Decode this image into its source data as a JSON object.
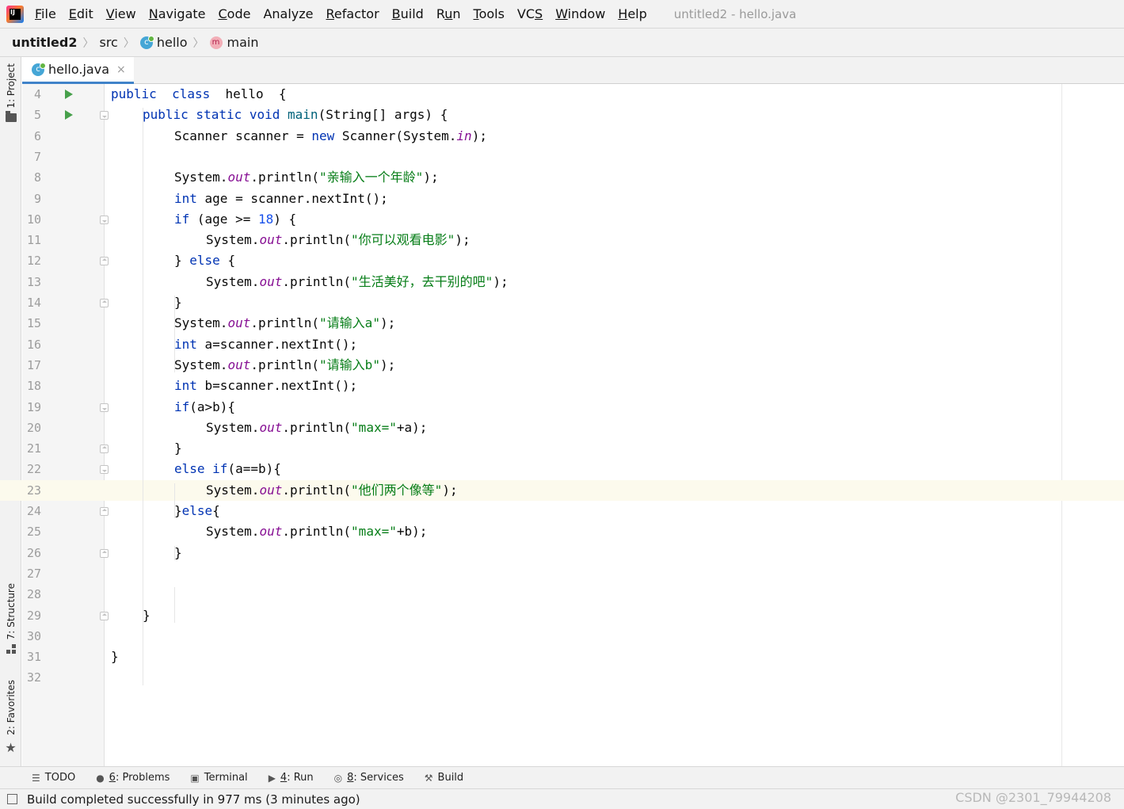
{
  "menubar": {
    "items": [
      {
        "label": "File",
        "key": "F"
      },
      {
        "label": "Edit",
        "key": "E"
      },
      {
        "label": "View",
        "key": "V"
      },
      {
        "label": "Navigate",
        "key": "N"
      },
      {
        "label": "Code",
        "key": "C"
      },
      {
        "label": "Analyze",
        "key": ""
      },
      {
        "label": "Refactor",
        "key": "R"
      },
      {
        "label": "Build",
        "key": "B"
      },
      {
        "label": "Run",
        "key": "u"
      },
      {
        "label": "Tools",
        "key": "T"
      },
      {
        "label": "VCS",
        "key": "S"
      },
      {
        "label": "Window",
        "key": "W"
      },
      {
        "label": "Help",
        "key": "H"
      }
    ],
    "window_title": "untitled2 - hello.java"
  },
  "navbar": {
    "project": "untitled2",
    "folder": "src",
    "class_name": "hello",
    "method_name": "main",
    "class_icon_letter": "c",
    "method_icon_letter": "m"
  },
  "tool_windows_left": {
    "project": "1: Project",
    "structure": "7: Structure",
    "favorites": "2: Favorites"
  },
  "editor": {
    "tab_label": "hello.java",
    "tab_close": "×",
    "current_line": 23,
    "lines": [
      {
        "num": "4",
        "gutter": "run",
        "fold": "",
        "indent": 0,
        "tokens": [
          [
            "kw",
            "public"
          ],
          [
            "",
            "  "
          ],
          [
            "kw",
            "class"
          ],
          [
            "",
            ""
          ],
          [
            "",
            "  hello  {"
          ]
        ]
      },
      {
        "num": "5",
        "gutter": "run",
        "fold": "open",
        "indent": 1,
        "tokens": [
          [
            "kw",
            "public static void "
          ],
          [
            "method",
            "main"
          ],
          [
            "",
            "(String[] args) {"
          ]
        ]
      },
      {
        "num": "6",
        "gutter": "",
        "fold": "",
        "indent": 2,
        "tokens": [
          [
            "",
            "Scanner scanner = "
          ],
          [
            "kw",
            "new "
          ],
          [
            "",
            "Scanner(System."
          ],
          [
            "field",
            "in"
          ],
          [
            "",
            ");"
          ]
        ]
      },
      {
        "num": "7",
        "gutter": "",
        "fold": "",
        "indent": 0,
        "tokens": []
      },
      {
        "num": "8",
        "gutter": "",
        "fold": "",
        "indent": 2,
        "tokens": [
          [
            "",
            "System."
          ],
          [
            "field",
            "out"
          ],
          [
            "",
            ".println("
          ],
          [
            "str",
            "\"亲输入一个年龄\""
          ],
          [
            "",
            ");"
          ]
        ]
      },
      {
        "num": "9",
        "gutter": "",
        "fold": "",
        "indent": 2,
        "tokens": [
          [
            "kw",
            "int "
          ],
          [
            "",
            "age = scanner.nextInt();"
          ]
        ]
      },
      {
        "num": "10",
        "gutter": "",
        "fold": "open",
        "indent": 2,
        "tokens": [
          [
            "kw",
            "if "
          ],
          [
            "",
            "(age >= "
          ],
          [
            "num",
            "18"
          ],
          [
            "",
            ") {"
          ]
        ]
      },
      {
        "num": "11",
        "gutter": "",
        "fold": "",
        "indent": 3,
        "tokens": [
          [
            "",
            "System."
          ],
          [
            "field",
            "out"
          ],
          [
            "",
            ".println("
          ],
          [
            "str",
            "\"你可以观看电影\""
          ],
          [
            "",
            ");"
          ]
        ]
      },
      {
        "num": "12",
        "gutter": "",
        "fold": "close",
        "indent": 2,
        "tokens": [
          [
            "",
            "} "
          ],
          [
            "kw",
            "else "
          ],
          [
            "",
            "{"
          ]
        ]
      },
      {
        "num": "13",
        "gutter": "",
        "fold": "",
        "indent": 3,
        "tokens": [
          [
            "",
            "System."
          ],
          [
            "field",
            "out"
          ],
          [
            "",
            ".println("
          ],
          [
            "str",
            "\"生活美好，去干别的吧\""
          ],
          [
            "",
            ");"
          ]
        ]
      },
      {
        "num": "14",
        "gutter": "",
        "fold": "close",
        "indent": 2,
        "tokens": [
          [
            "",
            "}"
          ]
        ]
      },
      {
        "num": "15",
        "gutter": "",
        "fold": "",
        "indent": 2,
        "tokens": [
          [
            "",
            "System."
          ],
          [
            "field",
            "out"
          ],
          [
            "",
            ".println("
          ],
          [
            "str",
            "\"请输入a\""
          ],
          [
            "",
            ");"
          ]
        ]
      },
      {
        "num": "16",
        "gutter": "",
        "fold": "",
        "indent": 2,
        "tokens": [
          [
            "kw",
            "int "
          ],
          [
            "",
            "a=scanner.nextInt();"
          ]
        ]
      },
      {
        "num": "17",
        "gutter": "",
        "fold": "",
        "indent": 2,
        "tokens": [
          [
            "",
            "System."
          ],
          [
            "field",
            "out"
          ],
          [
            "",
            ".println("
          ],
          [
            "str",
            "\"请输入b\""
          ],
          [
            "",
            ");"
          ]
        ]
      },
      {
        "num": "18",
        "gutter": "",
        "fold": "",
        "indent": 2,
        "tokens": [
          [
            "kw",
            "int "
          ],
          [
            "",
            "b=scanner.nextInt();"
          ]
        ]
      },
      {
        "num": "19",
        "gutter": "",
        "fold": "open",
        "indent": 2,
        "tokens": [
          [
            "kw",
            "if"
          ],
          [
            "",
            "(a>b){"
          ]
        ]
      },
      {
        "num": "20",
        "gutter": "",
        "fold": "",
        "indent": 3,
        "tokens": [
          [
            "",
            "System."
          ],
          [
            "field",
            "out"
          ],
          [
            "",
            ".println("
          ],
          [
            "str",
            "\"max=\""
          ],
          [
            "",
            "+a);"
          ]
        ]
      },
      {
        "num": "21",
        "gutter": "",
        "fold": "close",
        "indent": 2,
        "tokens": [
          [
            "",
            "}"
          ]
        ]
      },
      {
        "num": "22",
        "gutter": "",
        "fold": "open",
        "indent": 2,
        "tokens": [
          [
            "kw",
            "else if"
          ],
          [
            "",
            "(a==b){"
          ]
        ]
      },
      {
        "num": "23",
        "gutter": "",
        "fold": "",
        "indent": 3,
        "tokens": [
          [
            "",
            "System."
          ],
          [
            "field",
            "out"
          ],
          [
            "",
            ".println("
          ],
          [
            "str",
            "\"他们两个像等\""
          ],
          [
            "",
            ");"
          ]
        ]
      },
      {
        "num": "24",
        "gutter": "",
        "fold": "close",
        "indent": 2,
        "tokens": [
          [
            "",
            "}"
          ],
          [
            "kw",
            "else"
          ],
          [
            "",
            "{"
          ]
        ]
      },
      {
        "num": "25",
        "gutter": "",
        "fold": "",
        "indent": 3,
        "tokens": [
          [
            "",
            "System."
          ],
          [
            "field",
            "out"
          ],
          [
            "",
            ".println("
          ],
          [
            "str",
            "\"max=\""
          ],
          [
            "",
            "+b);"
          ]
        ]
      },
      {
        "num": "26",
        "gutter": "",
        "fold": "close",
        "indent": 2,
        "tokens": [
          [
            "",
            "}"
          ]
        ]
      },
      {
        "num": "27",
        "gutter": "",
        "fold": "",
        "indent": 0,
        "tokens": []
      },
      {
        "num": "28",
        "gutter": "",
        "fold": "",
        "indent": 0,
        "tokens": []
      },
      {
        "num": "29",
        "gutter": "",
        "fold": "close",
        "indent": 1,
        "tokens": [
          [
            "",
            "}"
          ]
        ]
      },
      {
        "num": "30",
        "gutter": "",
        "fold": "",
        "indent": 0,
        "tokens": []
      },
      {
        "num": "31",
        "gutter": "",
        "fold": "",
        "indent": 0,
        "tokens": [
          [
            "",
            "}"
          ]
        ]
      },
      {
        "num": "32",
        "gutter": "",
        "fold": "",
        "indent": 0,
        "tokens": []
      }
    ]
  },
  "bottom_toolbar": [
    {
      "icon": "list-icon",
      "glyph": "☰",
      "key": "",
      "label": "TODO"
    },
    {
      "icon": "problems-icon",
      "glyph": "●",
      "key": "6",
      "label": ": Problems"
    },
    {
      "icon": "terminal-icon",
      "glyph": "▣",
      "key": "",
      "label": "Terminal"
    },
    {
      "icon": "run-icon",
      "glyph": "▶",
      "key": "4",
      "label": ": Run"
    },
    {
      "icon": "services-icon",
      "glyph": "◎",
      "key": "8",
      "label": ": Services"
    },
    {
      "icon": "build-hammer-icon",
      "glyph": "⚒",
      "key": "",
      "label": "Build"
    }
  ],
  "statusbar": {
    "message": "Build completed successfully in 977 ms (3 minutes ago)"
  },
  "watermark": "CSDN @2301_79944208",
  "colors": {
    "keyword": "#0033b3",
    "string": "#067d17",
    "number": "#1750eb",
    "static_field": "#871094",
    "method_decl": "#00627a",
    "current_line_bg": "#fcfaed",
    "run_marker": "#47a04b"
  }
}
